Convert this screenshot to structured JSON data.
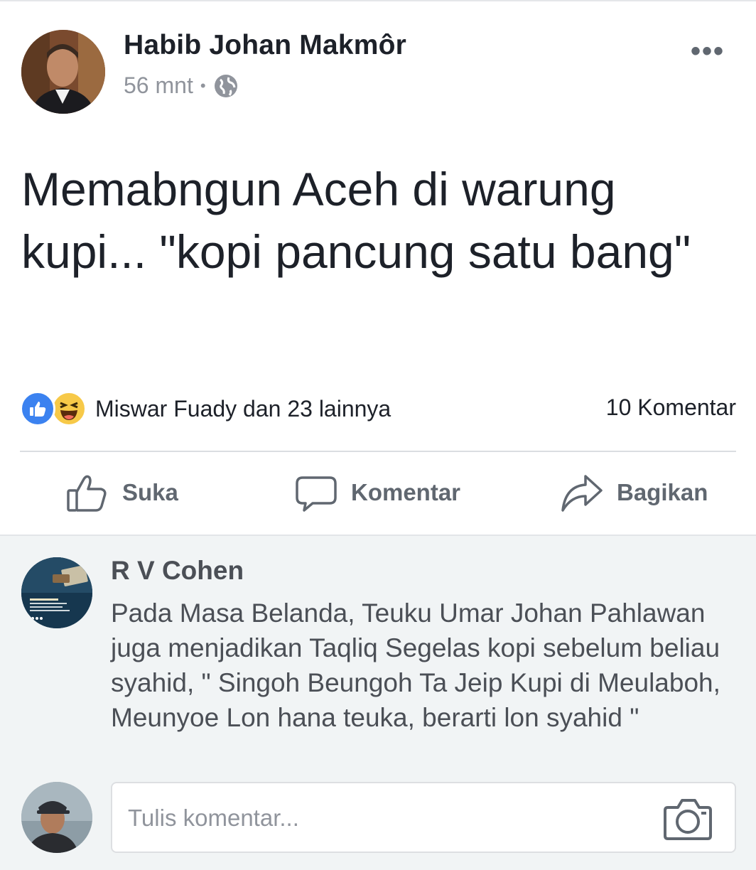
{
  "post": {
    "author": "Habib Johan Makmôr",
    "time": "56 mnt",
    "separator": "•",
    "text": "Memabngun Aceh di warung kupi... \"kopi pancung satu bang\"",
    "more_label": "•••",
    "reactions_text": "Miswar Fuady dan 23 lainnya",
    "comment_count": "10 Komentar",
    "reaction_icons": [
      "like-icon",
      "haha-icon"
    ]
  },
  "actions": {
    "like_label": "Suka",
    "comment_label": "Komentar",
    "share_label": "Bagikan"
  },
  "comment": {
    "author": "R V Cohen",
    "text": "Pada Masa Belanda, Teuku Umar Johan Pahlawan juga menjadikan Taqliq Segelas kopi sebelum beliau syahid, \" Singoh Beungoh Ta Jeip Kupi di Meulaboh, Meunyoe Lon hana teuka, berarti lon syahid \""
  },
  "composer": {
    "placeholder": "Tulis komentar..."
  },
  "colors": {
    "like_blue": "#3b82f0",
    "haha_yellow": "#f7c948",
    "muted_gray": "#606770",
    "comment_bg": "#f1f4f5"
  }
}
